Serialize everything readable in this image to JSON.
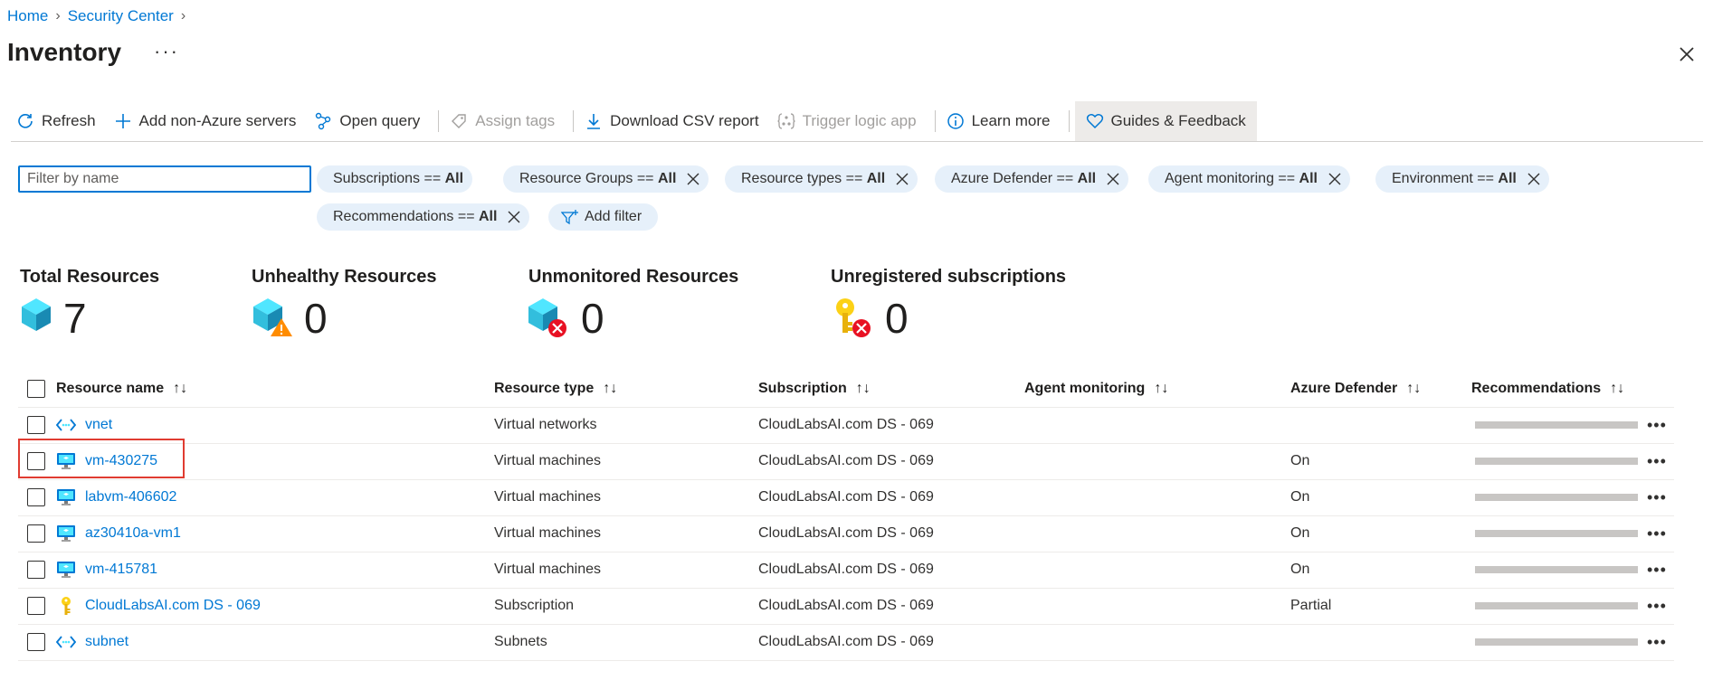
{
  "breadcrumb": {
    "home": "Home",
    "section": "Security Center"
  },
  "page": {
    "title": "Inventory",
    "more": "···"
  },
  "toolbar": {
    "refresh": "Refresh",
    "add_servers": "Add non-Azure servers",
    "open_query": "Open query",
    "assign_tags": "Assign tags",
    "download_csv": "Download CSV report",
    "trigger_logic": "Trigger logic app",
    "learn_more": "Learn more",
    "guides": "Guides & Feedback"
  },
  "filter": {
    "placeholder": "Filter by name"
  },
  "pills": [
    {
      "label": "Subscriptions == ",
      "value": "All"
    },
    {
      "label": "Resource Groups == ",
      "value": "All"
    },
    {
      "label": "Resource types == ",
      "value": "All"
    },
    {
      "label": "Azure Defender == ",
      "value": "All"
    },
    {
      "label": "Agent monitoring == ",
      "value": "All"
    },
    {
      "label": "Environment == ",
      "value": "All"
    },
    {
      "label": "Recommendations == ",
      "value": "All"
    }
  ],
  "add_filter": "Add filter",
  "stats": [
    {
      "title": "Total Resources",
      "value": "7"
    },
    {
      "title": "Unhealthy Resources",
      "value": "0"
    },
    {
      "title": "Unmonitored Resources",
      "value": "0"
    },
    {
      "title": "Unregistered subscriptions",
      "value": "0"
    }
  ],
  "table": {
    "headers": {
      "name": "Resource name",
      "type": "Resource type",
      "subscription": "Subscription",
      "agent": "Agent monitoring",
      "defender": "Azure Defender",
      "recs": "Recommendations"
    },
    "rows": [
      {
        "name": "vnet",
        "type": "Virtual networks",
        "subscription": "CloudLabsAI.com DS - 069",
        "agent": "",
        "defender": "",
        "icon": "vnet-icon"
      },
      {
        "name": "vm-430275",
        "type": "Virtual machines",
        "subscription": "CloudLabsAI.com DS - 069",
        "agent": "",
        "defender": "On",
        "icon": "vm-icon"
      },
      {
        "name": "labvm-406602",
        "type": "Virtual machines",
        "subscription": "CloudLabsAI.com DS - 069",
        "agent": "",
        "defender": "On",
        "icon": "vm-icon"
      },
      {
        "name": "az30410a-vm1",
        "type": "Virtual machines",
        "subscription": "CloudLabsAI.com DS - 069",
        "agent": "",
        "defender": "On",
        "icon": "vm-icon"
      },
      {
        "name": "vm-415781",
        "type": "Virtual machines",
        "subscription": "CloudLabsAI.com DS - 069",
        "agent": "",
        "defender": "On",
        "icon": "vm-icon"
      },
      {
        "name": "CloudLabsAI.com DS - 069",
        "type": "Subscription",
        "subscription": "CloudLabsAI.com DS - 069",
        "agent": "",
        "defender": "Partial",
        "icon": "key-icon"
      },
      {
        "name": "subnet",
        "type": "Subnets",
        "subscription": "CloudLabsAI.com DS - 069",
        "agent": "",
        "defender": "",
        "icon": "vnet-icon"
      }
    ]
  },
  "row_more": "•••",
  "colors": {
    "accent": "#0078d4",
    "pill_bg": "#e6f0fa",
    "highlight": "#e03c31"
  }
}
